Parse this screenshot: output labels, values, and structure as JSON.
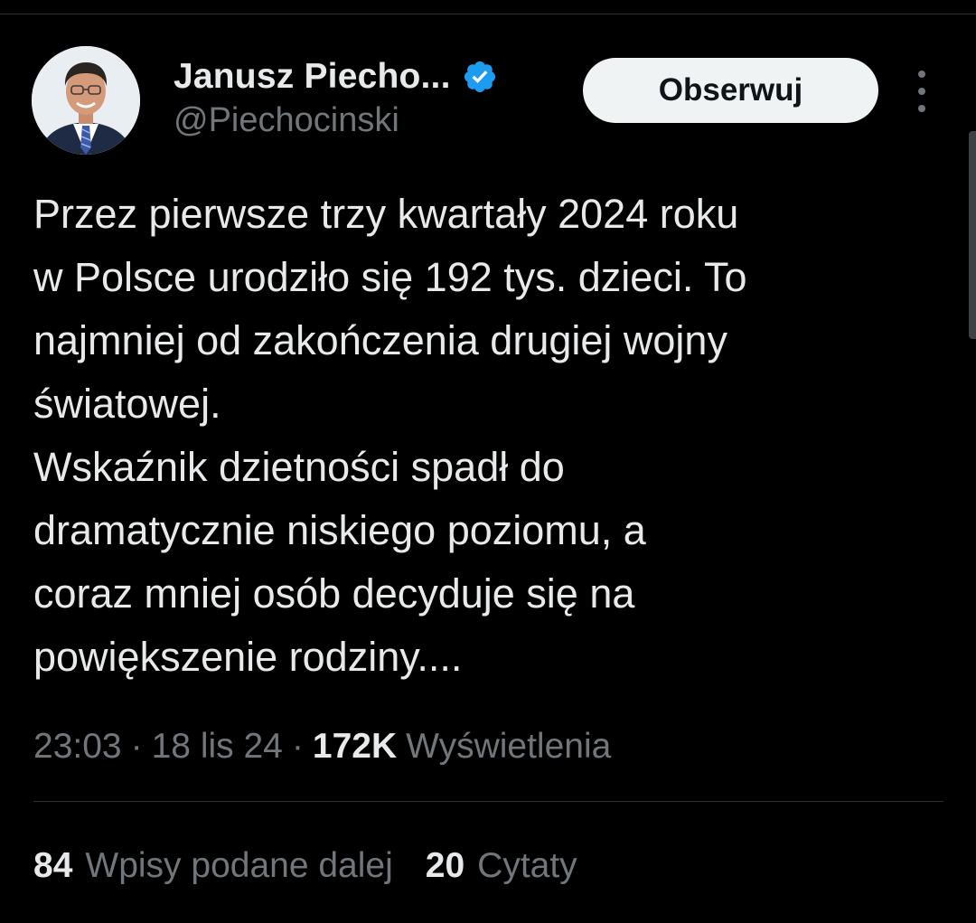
{
  "author": {
    "display_name": "Janusz Piecho...",
    "handle": "@Piechocinski",
    "verified": true
  },
  "follow_button": {
    "label": "Obserwuj"
  },
  "tweet": {
    "lines": [
      "Przez pierwsze trzy kwartały 2024 roku",
      "w Polsce urodziło się 192 tys. dzieci. To",
      "najmniej od zakończenia drugiej wojny",
      "światowej.",
      "Wskaźnik dzietności spadł do",
      "dramatycznie niskiego poziomu, a",
      "coraz mniej osób decyduje się na",
      "powiększenie rodziny...."
    ]
  },
  "meta": {
    "time": "23:03",
    "separator": "·",
    "date": "18 lis 24",
    "views_count": "172K",
    "views_label": "Wyświetlenia"
  },
  "stats": {
    "reposts_count": "84",
    "reposts_label": "Wpisy podane dalej",
    "quotes_count": "20",
    "quotes_label": "Cytaty"
  },
  "icons": {
    "verified": "verified-badge-icon",
    "more": "more-vertical-icon"
  },
  "colors": {
    "background": "#000000",
    "text_primary": "#e7e9ea",
    "text_secondary": "#71767b",
    "verified_blue": "#1d9bf0",
    "button_bg": "#eff3f4",
    "divider": "#2f3336"
  }
}
